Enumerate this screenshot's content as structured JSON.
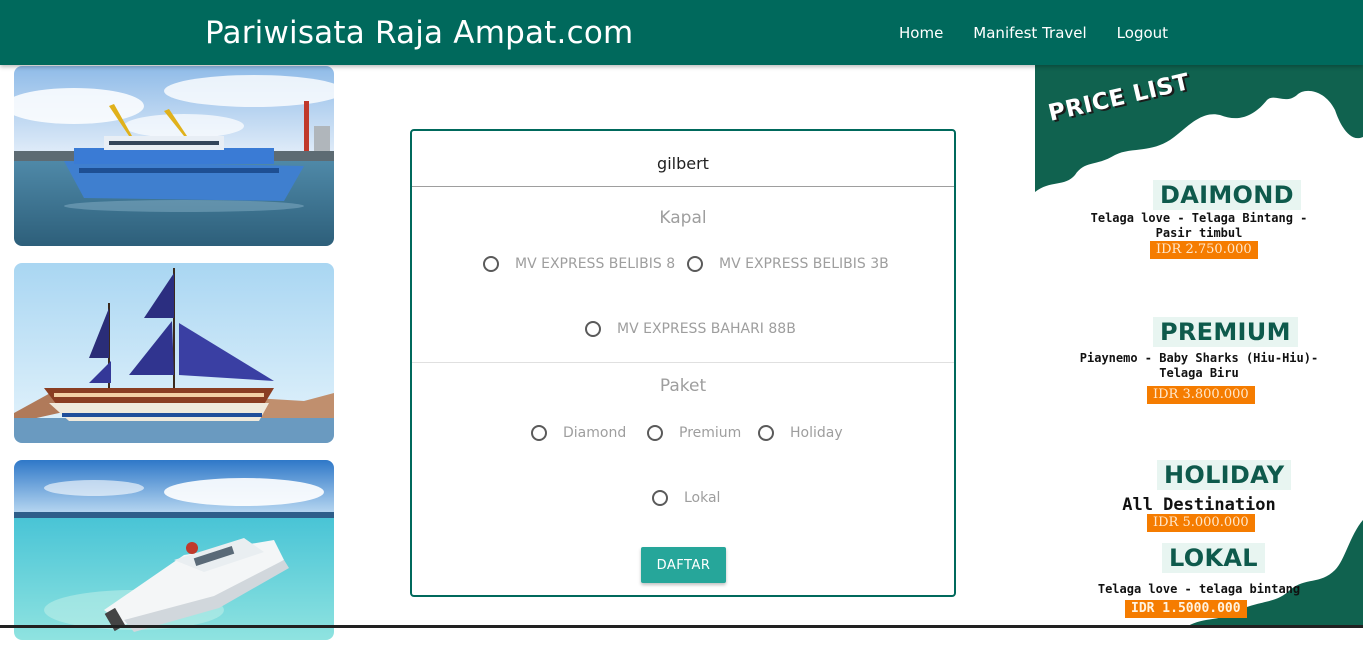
{
  "nav": {
    "brand": "Pariwisata Raja Ampat.com",
    "links": [
      "Home",
      "Manifest Travel",
      "Logout"
    ]
  },
  "form": {
    "name_value": "gilbert",
    "kapal_title": "Kapal",
    "kapal_options": [
      "MV EXPRESS BELIBIS 8",
      "MV EXPRESS BELIBIS 3B",
      "MV EXPRESS BAHARI 88B"
    ],
    "paket_title": "Paket",
    "paket_options": [
      "Diamond",
      "Premium",
      "Holiday",
      "Lokal"
    ],
    "submit_label": "DAFTAR"
  },
  "pricelist": {
    "title": "PRICE LIST",
    "packages": [
      {
        "name": "DAIMOND",
        "destination_1": "Telaga love - Telaga Bintang -",
        "destination_2": "Pasir timbul",
        "price": "IDR 2.750.000"
      },
      {
        "name": "PREMIUM",
        "destination_1": "Piaynemo - Baby Sharks (Hiu-Hiu)-",
        "destination_2": "Telaga Biru",
        "price": "IDR 3.800.000"
      },
      {
        "name": "HOLIDAY",
        "destination_1": "All Destination",
        "price": "IDR 5.000.000"
      },
      {
        "name": "LOKAL",
        "destination_1": "Telaga love - telaga bintang",
        "price": "IDR 1.5000.000"
      }
    ]
  },
  "colors": {
    "primary": "#00695c",
    "accent": "#26a69a",
    "price_tag": "#f57c00"
  }
}
